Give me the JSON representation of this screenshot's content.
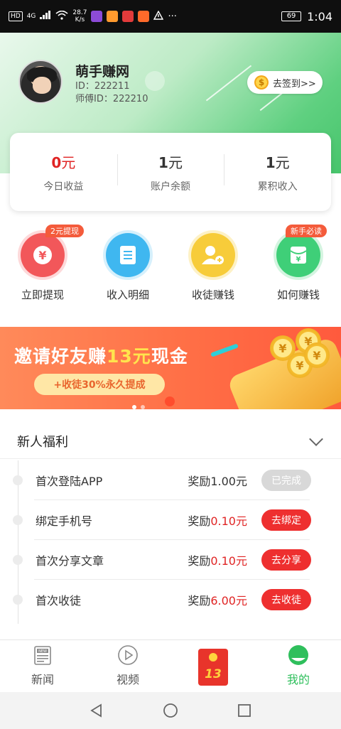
{
  "status_bar": {
    "hd": "HD",
    "network": "4G",
    "speed_value": "28.7",
    "speed_unit": "K/s",
    "battery": "69",
    "time": "1:04",
    "more": "···"
  },
  "profile": {
    "name": "萌手赚网",
    "id": "ID：222211",
    "master_id": "师傅ID：222210",
    "checkin_label": "去签到>>",
    "coin_symbol": "$"
  },
  "stats": [
    {
      "value": "0",
      "unit": "元",
      "label": "今日收益",
      "highlight": true
    },
    {
      "value": "1",
      "unit": "元",
      "label": "账户余额",
      "highlight": false
    },
    {
      "value": "1",
      "unit": "元",
      "label": "累积收入",
      "highlight": false
    }
  ],
  "quick_actions": [
    {
      "label": "立即提现",
      "badge": "2元提现",
      "color": "#f2575a",
      "glyph": "¥",
      "icon": "yuan-icon"
    },
    {
      "label": "收入明细",
      "badge": "",
      "color": "#3fb7f0",
      "glyph": "≡",
      "icon": "document-icon"
    },
    {
      "label": "收徒赚钱",
      "badge": "",
      "color": "#f7cc3a",
      "glyph": "+",
      "icon": "add-user-icon"
    },
    {
      "label": "如何赚钱",
      "badge": "新手必读",
      "color": "#3fcf78",
      "glyph": "¥",
      "icon": "money-envelope-icon"
    }
  ],
  "banner": {
    "title_pre": "邀请好友赚",
    "title_amount": "13元",
    "title_post": "现金",
    "subtitle": "+收徒30%永久提成",
    "coin_glyph": "¥"
  },
  "welfare": {
    "title": "新人福利",
    "reward_prefix": "奖励",
    "tasks": [
      {
        "name": "首次登陆APP",
        "amount": "1.00元",
        "button": "已完成",
        "done": true
      },
      {
        "name": "绑定手机号",
        "amount": "0.10元",
        "button": "去绑定",
        "done": false
      },
      {
        "name": "首次分享文章",
        "amount": "0.10元",
        "button": "去分享",
        "done": false
      },
      {
        "name": "首次收徒",
        "amount": "6.00元",
        "button": "去收徒",
        "done": false
      }
    ]
  },
  "tabbar": {
    "news": "新闻",
    "video": "视频",
    "redpack_number": "13",
    "mine": "我的",
    "news_icon_text": "NEW"
  },
  "colors": {
    "accent_green": "#2fbf5c",
    "accent_red": "#e02424",
    "button_red": "#ee2f2f"
  }
}
